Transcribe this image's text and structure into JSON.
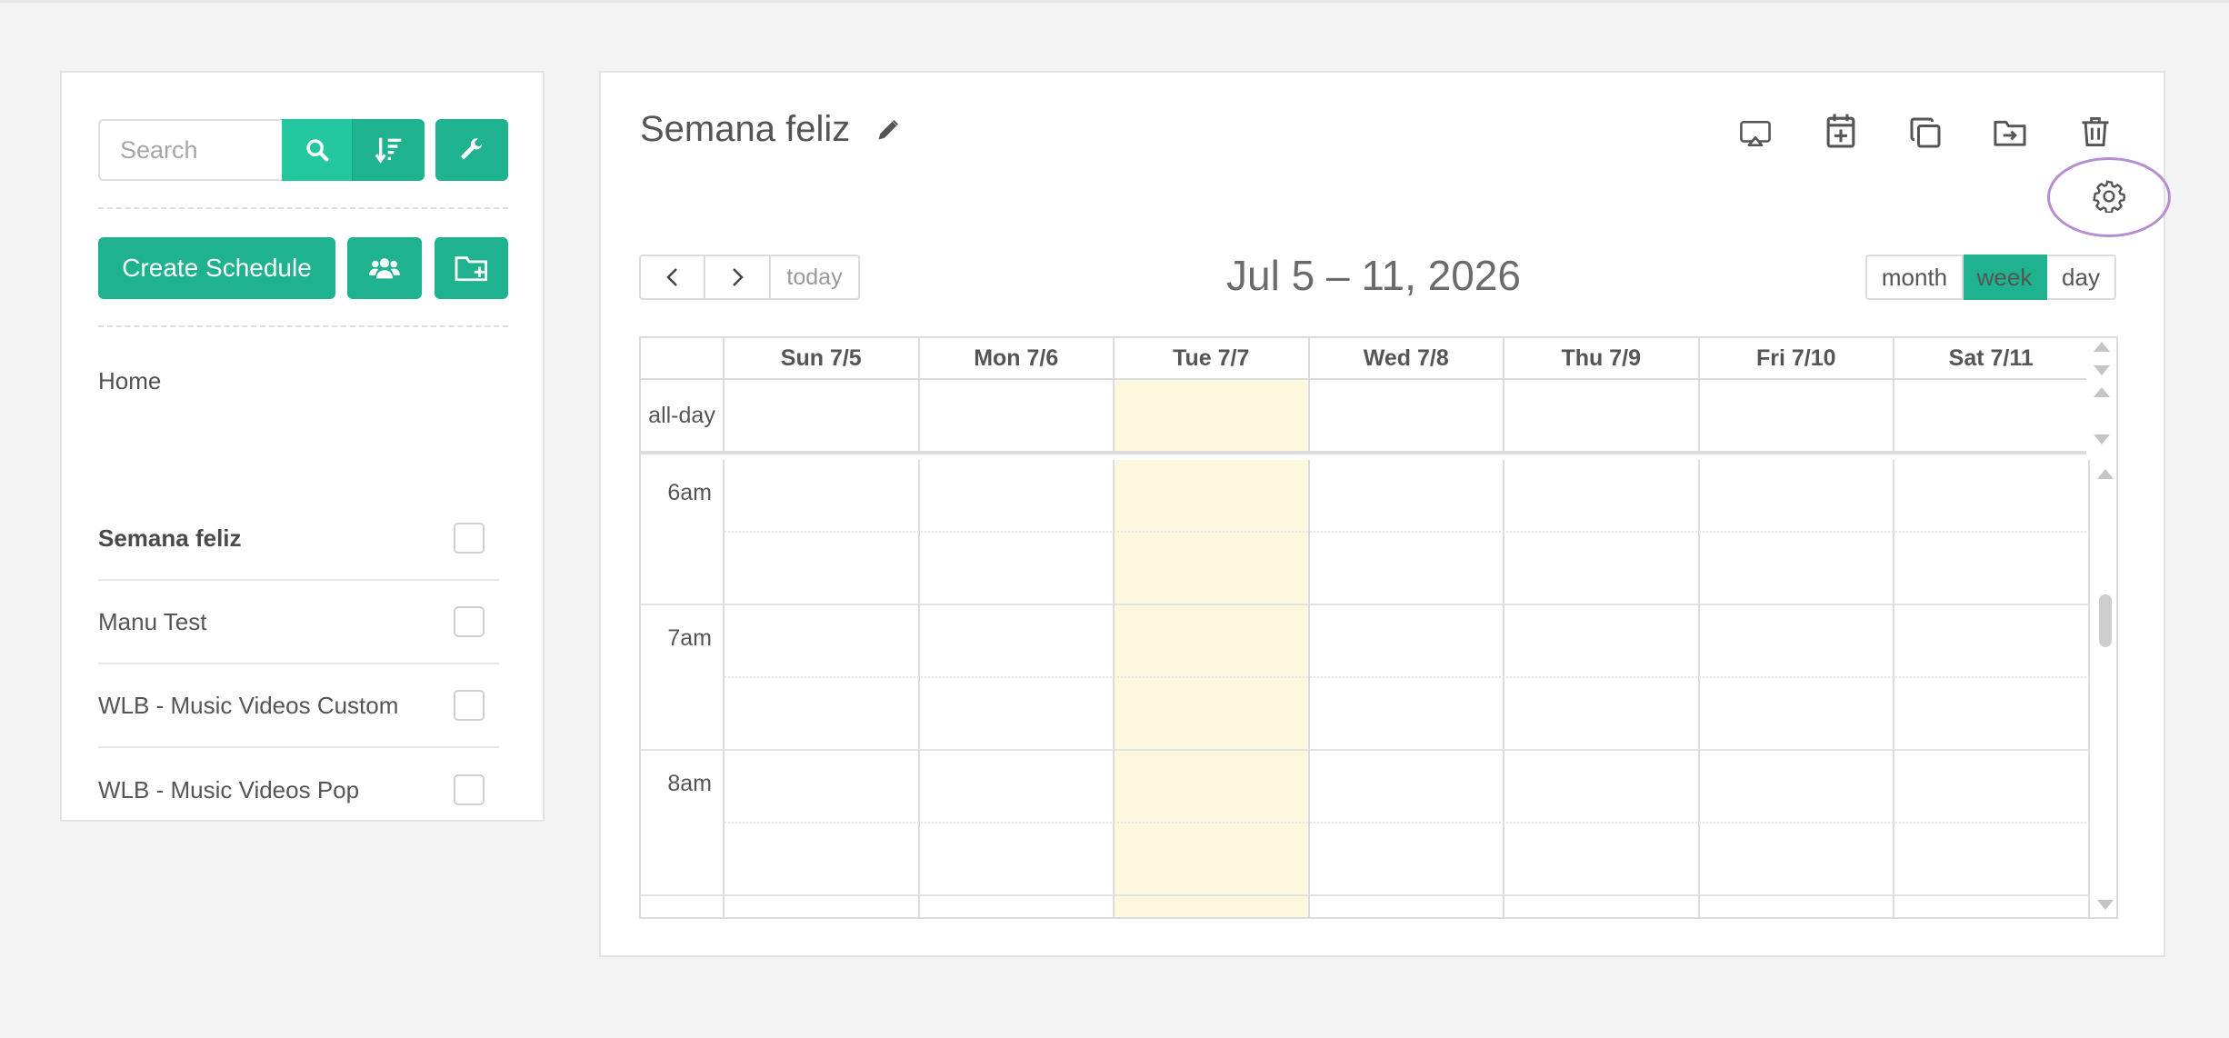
{
  "sidebar": {
    "search": {
      "placeholder": "Search",
      "value": ""
    },
    "create_label": "Create Schedule",
    "home_label": "Home",
    "schedules": [
      {
        "name": "Semana feliz",
        "active": true,
        "checked": false
      },
      {
        "name": "Manu Test",
        "active": false,
        "checked": false
      },
      {
        "name": "WLB - Music Videos Custom",
        "active": false,
        "checked": false
      },
      {
        "name": "WLB - Music Videos Pop",
        "active": false,
        "checked": false
      }
    ]
  },
  "main": {
    "title": "Semana feliz",
    "toolbar_icons": [
      "cast-icon",
      "calendar-add-icon",
      "copy-icon",
      "folder-move-icon",
      "trash-icon",
      "gear-icon"
    ],
    "nav": {
      "today_label": "today"
    },
    "range_title": "Jul 5 – 11, 2026",
    "views": {
      "month": "month",
      "week": "week",
      "day": "day",
      "active": "week"
    },
    "calendar": {
      "days": [
        "Sun 7/5",
        "Mon 7/6",
        "Tue 7/7",
        "Wed 7/8",
        "Thu 7/9",
        "Fri 7/10",
        "Sat 7/11"
      ],
      "today_index": 2,
      "allday_label": "all-day",
      "hours": [
        "6am",
        "7am",
        "8am"
      ]
    }
  },
  "colors": {
    "accent": "#1eb28e",
    "accent_light": "#22c7a0",
    "today_bg": "#fdf8dd",
    "highlight_ring": "#b88cd0"
  }
}
